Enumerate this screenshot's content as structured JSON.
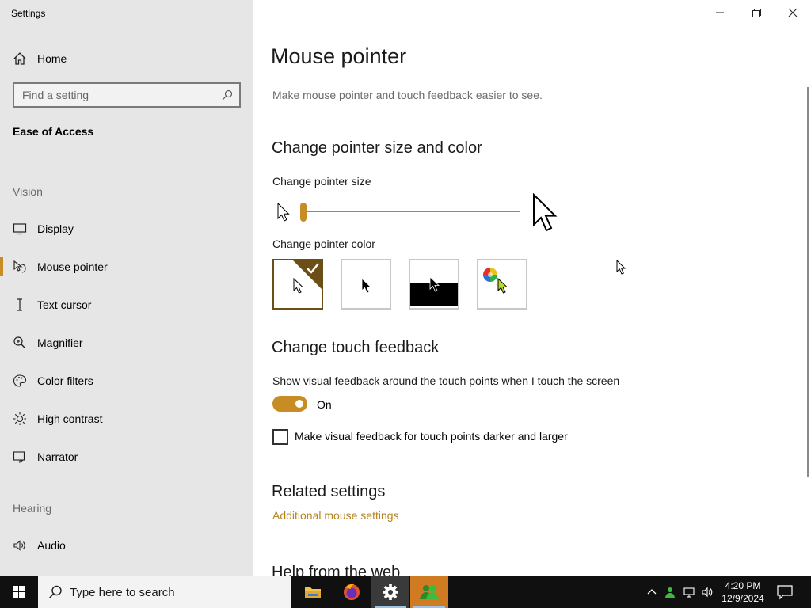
{
  "window": {
    "title": "Settings"
  },
  "sidebar": {
    "home_label": "Home",
    "search_placeholder": "Find a setting",
    "section_title": "Ease of Access",
    "vision_label": "Vision",
    "items": [
      {
        "label": "Display",
        "icon": "monitor-icon"
      },
      {
        "label": "Mouse pointer",
        "icon": "mouse-pointer-icon",
        "active": true
      },
      {
        "label": "Text cursor",
        "icon": "text-cursor-icon"
      },
      {
        "label": "Magnifier",
        "icon": "magnifier-icon"
      },
      {
        "label": "Color filters",
        "icon": "palette-icon"
      },
      {
        "label": "High contrast",
        "icon": "sun-icon"
      },
      {
        "label": "Narrator",
        "icon": "narrator-icon"
      }
    ],
    "hearing_label": "Hearing",
    "hearing_items": [
      {
        "label": "Audio",
        "icon": "speaker-icon"
      }
    ]
  },
  "main": {
    "title": "Mouse pointer",
    "subtitle": "Make mouse pointer and touch feedback easier to see.",
    "size_color_heading": "Change pointer size and color",
    "size_label": "Change pointer size",
    "size_value": 1,
    "color_label": "Change pointer color",
    "color_options": [
      "white",
      "black",
      "inverted",
      "custom"
    ],
    "selected_color": "white",
    "touch_heading": "Change touch feedback",
    "touch_label": "Show visual feedback around the touch points when I touch the screen",
    "touch_toggle_state": "On",
    "touch_darker_label": "Make visual feedback for touch points darker and larger",
    "touch_darker_checked": false,
    "related_heading": "Related settings",
    "related_link": "Additional mouse settings",
    "help_heading": "Help from the web"
  },
  "taskbar": {
    "search_placeholder": "Type here to search",
    "apps": [
      "file-explorer-icon",
      "firefox-icon",
      "settings-gear-icon",
      "people-app-icon"
    ],
    "time": "4:20 PM",
    "date": "12/9/2024"
  },
  "colors": {
    "accent": "#c78d24",
    "sidebar_bg": "#e6e6e6",
    "taskbar_bg": "#101010"
  }
}
